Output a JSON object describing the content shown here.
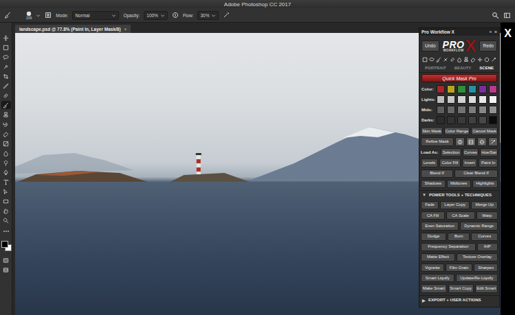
{
  "window": {
    "title": "Adobe Photoshop CC 2017"
  },
  "options_bar": {
    "brush_size": "209",
    "mode_label": "Mode:",
    "mode": "Normal",
    "opacity_label": "Opacity:",
    "opacity": "100%",
    "flow_label": "Flow:",
    "flow": "30%"
  },
  "toolbar": {
    "tools": [
      {
        "selected": false
      },
      {
        "selected": false
      },
      {
        "selected": false
      },
      {
        "selected": false
      },
      {
        "selected": false
      },
      {
        "selected": false
      },
      {
        "selected": false
      },
      {
        "selected": true
      },
      {
        "selected": false
      },
      {
        "selected": false
      },
      {
        "selected": false
      },
      {
        "selected": false
      },
      {
        "selected": false
      },
      {
        "selected": false
      },
      {
        "selected": false
      },
      {
        "selected": false
      },
      {
        "selected": false
      },
      {
        "selected": false
      },
      {
        "selected": false
      },
      {
        "selected": false
      }
    ]
  },
  "document_tab": {
    "title": "landscape.psd @ 77.8% (Paint In, Layer Mask/8)",
    "close": "×"
  },
  "panel": {
    "title": "Pro Workflow X",
    "collapse": "»",
    "menu": "≡",
    "undo": "Undo",
    "redo": "Redo",
    "logo": {
      "word": "PRO",
      "subword": "WORKFLOW",
      "mark": "X"
    },
    "tabs": [
      {
        "label": "PORTRAIT",
        "selected": false
      },
      {
        "label": "BEAUTY",
        "selected": false
      },
      {
        "label": "SCENE",
        "selected": true
      }
    ],
    "quick_mask": "Quick Mask Pro",
    "swatch_rows": [
      {
        "label": "Color:",
        "swatches": [
          {
            "color": "#a8262b"
          },
          {
            "color": "#b8a422"
          },
          {
            "color": "#2f8f3a"
          },
          {
            "color": "#2a8fa3"
          },
          {
            "color": "#7a2f9a"
          },
          {
            "color": "#b83a8a"
          }
        ]
      },
      {
        "label": "Lights:",
        "swatches": [
          {
            "color": "#bdbdbd"
          },
          {
            "color": "#c8c8c8"
          },
          {
            "color": "#d2d2d2"
          },
          {
            "color": "#dcdcdc"
          },
          {
            "color": "#e8e8e8"
          },
          {
            "color": "#f4f4f4"
          }
        ]
      },
      {
        "label": "Mids:",
        "swatches": [
          {
            "color": "#5e5e5e"
          },
          {
            "color": "#686868"
          },
          {
            "color": "#727272"
          },
          {
            "color": "#7c7c7c"
          },
          {
            "color": "#878787"
          },
          {
            "color": "#929292"
          }
        ]
      },
      {
        "label": "Darks:",
        "swatches": [
          {
            "color": "#2c2c2c"
          },
          {
            "color": "#333333"
          },
          {
            "color": "#3a3a3a"
          },
          {
            "color": "#414141"
          },
          {
            "color": "#484848"
          },
          {
            "color": "#0c0c0c"
          }
        ]
      }
    ],
    "tool_rows": [
      [
        {
          "kind": "button",
          "label": "Skin Mask"
        },
        {
          "kind": "button",
          "label": "Color Range"
        },
        {
          "kind": "button",
          "label": "Cancel Mask"
        }
      ],
      [
        {
          "kind": "button",
          "label": "Refine Mask"
        },
        {
          "kind": "icon"
        },
        {
          "kind": "icon"
        },
        {
          "kind": "icon"
        },
        {
          "kind": "icon"
        }
      ],
      [
        {
          "kind": "label",
          "label": "Load As:"
        },
        {
          "kind": "button",
          "label": "Selection"
        },
        {
          "kind": "button",
          "label": "Curves"
        },
        {
          "kind": "button",
          "label": "Hue/Sat"
        }
      ],
      [
        {
          "kind": "button",
          "label": "Levels"
        },
        {
          "kind": "button",
          "label": "Color Fill"
        },
        {
          "kind": "button",
          "label": "Invert"
        },
        {
          "kind": "button",
          "label": "Paint In"
        }
      ],
      [
        {
          "kind": "button",
          "label": "Blend If"
        },
        {
          "kind": "button",
          "label": "Clear Blend If"
        }
      ],
      [
        {
          "kind": "button",
          "label": "Shadows"
        },
        {
          "kind": "button",
          "label": "Midtones"
        },
        {
          "kind": "button",
          "label": "Highlights"
        }
      ]
    ],
    "sections": [
      {
        "glyph": "▼",
        "title": "POWER TOOLS + TECHNIQUES",
        "expanded": true,
        "rows": [
          [
            "Fade",
            "Layer Copy",
            "Merge Up"
          ],
          [
            "CA Fill",
            "CA Scale",
            "Warp"
          ],
          [
            "Even Saturation",
            "Dynamic Range"
          ],
          [
            "Dodge",
            "Burn",
            "Curves"
          ],
          [
            "Frequency Separation",
            "IHP"
          ],
          [
            "Matte Effect",
            "Texture Overlay"
          ],
          [
            "Vignette",
            "Film Grain",
            "Sharpen"
          ],
          [
            "Smart Liquify",
            "Update/Re-Liquify"
          ],
          [
            "Make Smart",
            "Smart Copy",
            "Edit Smart"
          ]
        ]
      },
      {
        "glyph": "▶",
        "title": "EXPORT + USER ACTIONS",
        "expanded": false,
        "rows": []
      }
    ]
  },
  "viewer": {
    "close": "X"
  }
}
